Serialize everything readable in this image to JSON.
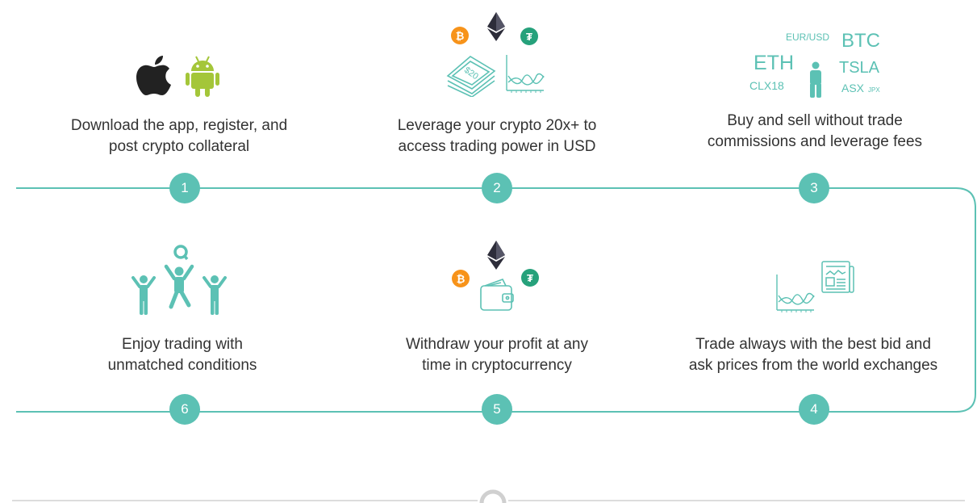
{
  "colors": {
    "accent": "#5cc1b4",
    "bitcoin": "#f7931a",
    "tether": "#26a17b",
    "ethereum": "#2d2d3a",
    "apple": "#222222",
    "android": "#a4c639"
  },
  "steps": [
    {
      "number": "1",
      "text_line1": "Download the app, register, and",
      "text_line2": "post crypto collateral"
    },
    {
      "number": "2",
      "text_line1": "Leverage your crypto 20x+ to",
      "text_line2": "access trading power in USD"
    },
    {
      "number": "3",
      "text_line1": "Buy and sell without trade",
      "text_line2": "commissions and leverage fees"
    },
    {
      "number": "4",
      "text_line1": "Trade always with the best bid and",
      "text_line2": "ask prices from the world exchanges"
    },
    {
      "number": "5",
      "text_line1": "Withdraw your profit at any",
      "text_line2": "time in cryptocurrency"
    },
    {
      "number": "6",
      "text_line1": "Enjoy trading with",
      "text_line2": "unmatched conditions"
    }
  ],
  "coins": {
    "btc_symbol": "₿",
    "usdt_symbol": "₮"
  },
  "banknote_label": "$20",
  "tickers": {
    "eurusd": "EUR/USD",
    "btc": "BTC",
    "eth": "ETH",
    "tsla": "TSLA",
    "clx18": "CLX18",
    "asx": "ASX",
    "jpx": "JPX"
  },
  "mascot_letter": "Q"
}
